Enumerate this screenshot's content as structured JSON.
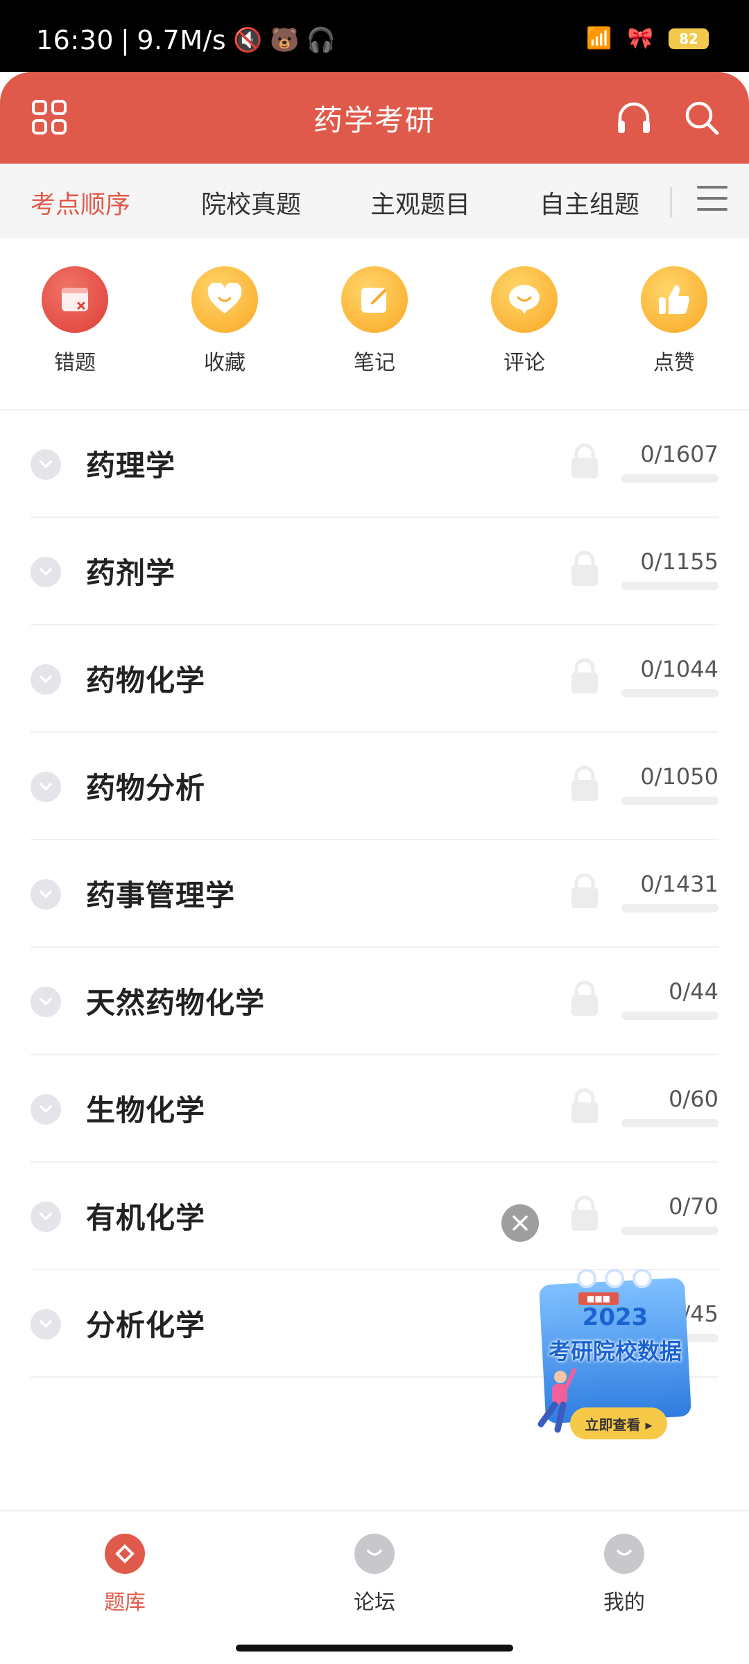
{
  "status_bar": {
    "time": "16:30",
    "speed": "9.7M/s",
    "battery": "82"
  },
  "header": {
    "title": "药学考研",
    "icons": [
      "apps-grid-icon",
      "headphones-icon",
      "search-icon"
    ]
  },
  "tabs": [
    {
      "label": "考点顺序",
      "active": true
    },
    {
      "label": "院校真题",
      "active": false
    },
    {
      "label": "主观题目",
      "active": false
    },
    {
      "label": "自主组题",
      "active": false
    }
  ],
  "quick_actions": [
    {
      "label": "错题",
      "icon": "wrong-questions-icon"
    },
    {
      "label": "收藏",
      "icon": "favorite-heart-icon"
    },
    {
      "label": "笔记",
      "icon": "notes-edit-icon"
    },
    {
      "label": "评论",
      "icon": "comment-bubble-icon"
    },
    {
      "label": "点赞",
      "icon": "thumbs-up-icon"
    }
  ],
  "subjects": [
    {
      "title": "药理学",
      "count": "0/1607",
      "progress": 0
    },
    {
      "title": "药剂学",
      "count": "0/1155",
      "progress": 0
    },
    {
      "title": "药物化学",
      "count": "0/1044",
      "progress": 0
    },
    {
      "title": "药物分析",
      "count": "0/1050",
      "progress": 0
    },
    {
      "title": "药事管理学",
      "count": "0/1431",
      "progress": 0
    },
    {
      "title": "天然药物化学",
      "count": "0/44",
      "progress": 0
    },
    {
      "title": "生物化学",
      "count": "0/60",
      "progress": 0
    },
    {
      "title": "有机化学",
      "count": "0/70",
      "progress": 0
    },
    {
      "title": "分析化学",
      "count": "0/45",
      "progress": 0
    }
  ],
  "promo": {
    "year": "2023",
    "text": "考研院校数据",
    "button": "立即查看 ▸"
  },
  "bottom_nav": [
    {
      "label": "题库",
      "active": true
    },
    {
      "label": "论坛",
      "active": false
    },
    {
      "label": "我的",
      "active": false
    }
  ],
  "colors": {
    "brand": "#e05a4b",
    "accent_yellow": "#f9a825"
  }
}
